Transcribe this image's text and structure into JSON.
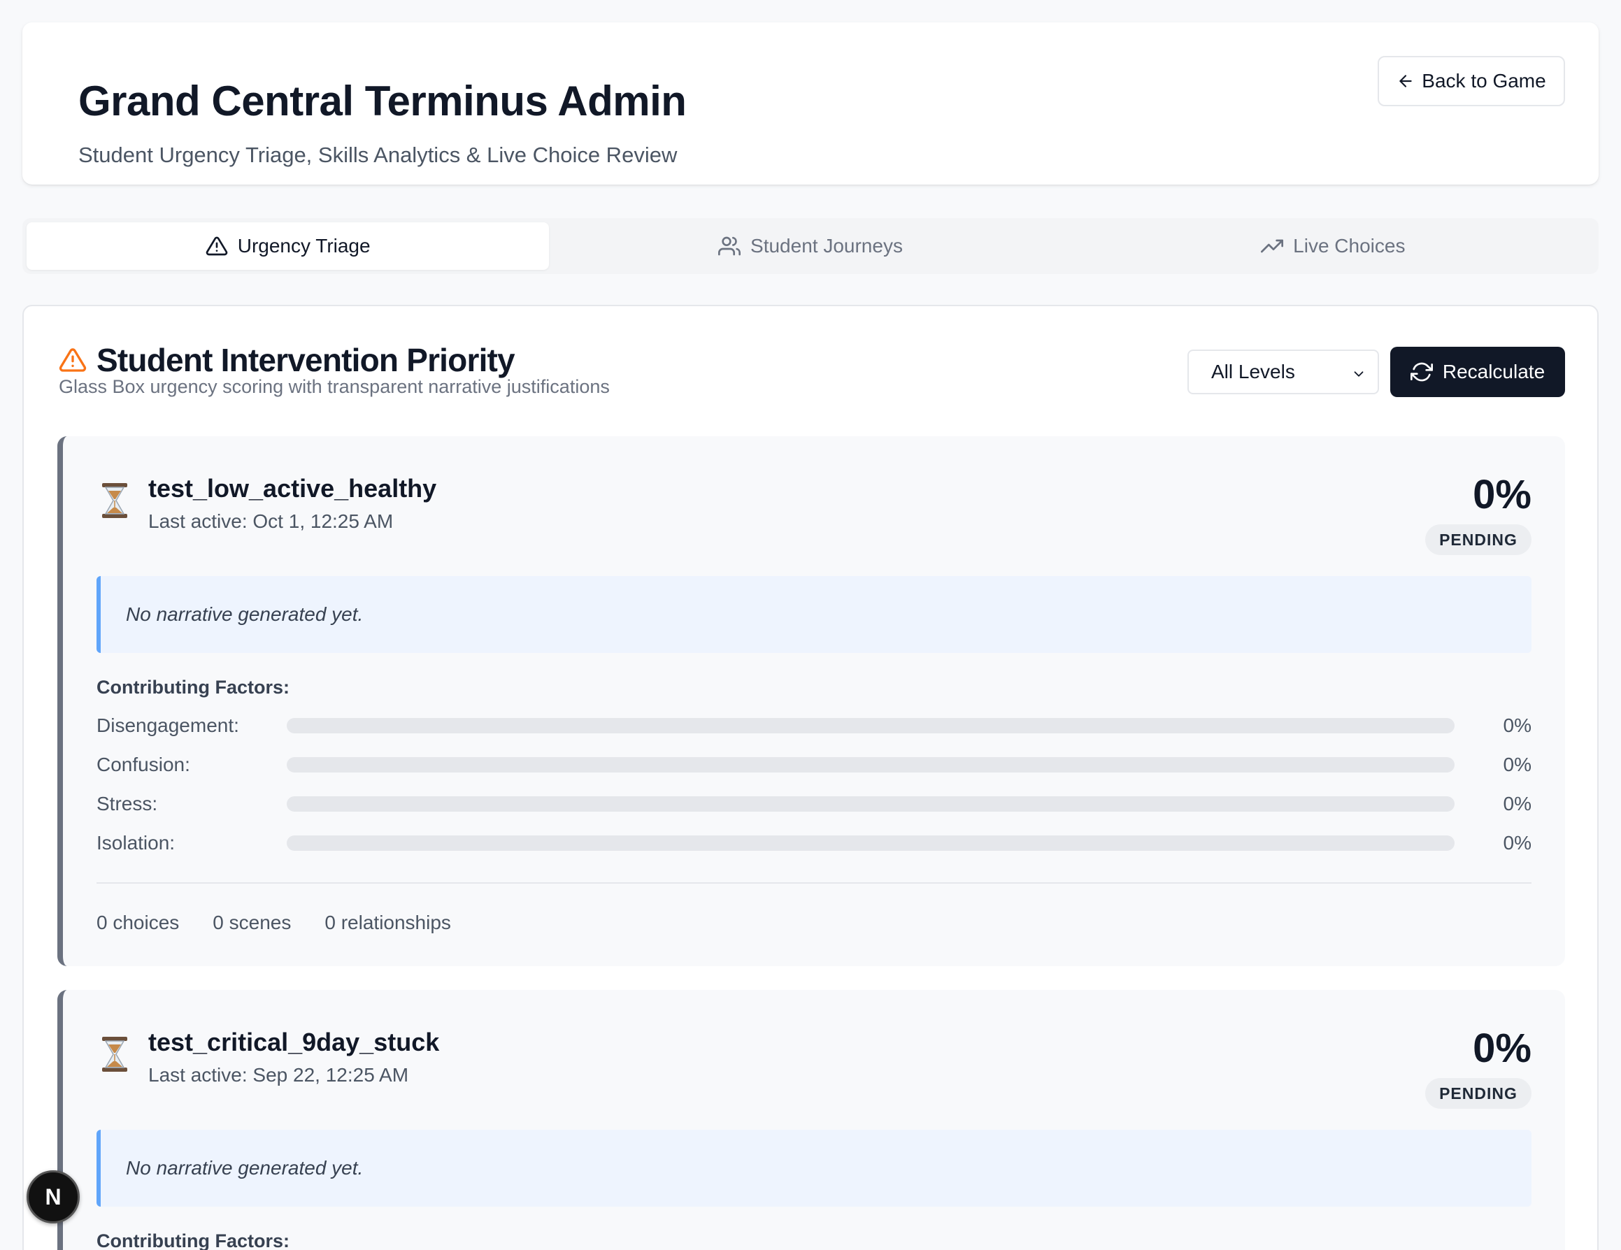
{
  "header": {
    "title": "Grand Central Terminus Admin",
    "subtitle": "Student Urgency Triage, Skills Analytics & Live Choice Review",
    "back_button": "Back to Game"
  },
  "tabs": [
    {
      "label": "Urgency Triage",
      "icon": "alert-triangle-icon",
      "active": true
    },
    {
      "label": "Student Journeys",
      "icon": "users-icon",
      "active": false
    },
    {
      "label": "Live Choices",
      "icon": "trending-up-icon",
      "active": false
    }
  ],
  "section": {
    "title": "Student Intervention Priority",
    "subtitle": "Glass Box urgency scoring with transparent narrative justifications",
    "level_filter": "All Levels",
    "recalculate_label": "Recalculate"
  },
  "students": [
    {
      "name": "test_low_active_healthy",
      "last_active": "Last active: Oct 1, 12:25 AM",
      "score": "0%",
      "status": "PENDING",
      "narrative": "No narrative generated yet.",
      "factors_title": "Contributing Factors:",
      "factors": [
        {
          "label": "Disengagement:",
          "value": "0%",
          "level": 0
        },
        {
          "label": "Confusion:",
          "value": "0%",
          "level": 0
        },
        {
          "label": "Stress:",
          "value": "0%",
          "level": 0
        },
        {
          "label": "Isolation:",
          "value": "0%",
          "level": 0
        }
      ],
      "stats": {
        "choices": "0 choices",
        "scenes": "0 scenes",
        "relationships": "0 relationships"
      }
    },
    {
      "name": "test_critical_9day_stuck",
      "last_active": "Last active: Sep 22, 12:25 AM",
      "score": "0%",
      "status": "PENDING",
      "narrative": "No narrative generated yet.",
      "factors_title": "Contributing Factors:"
    }
  ],
  "dev_badge": "N",
  "colors": {
    "accent_dark": "#111827",
    "warning_orange": "#f97316",
    "narrative_border": "#60a5fa",
    "card_border": "#6b7280"
  }
}
